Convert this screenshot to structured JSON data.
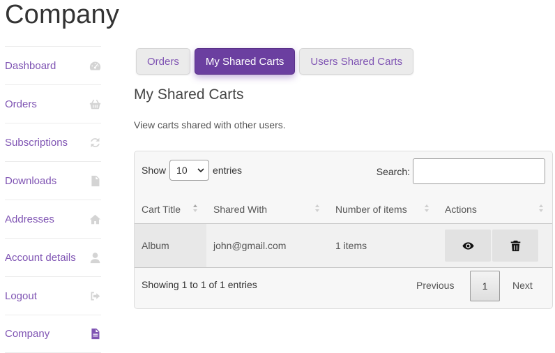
{
  "page": {
    "title": "Company"
  },
  "sidebar": {
    "items": [
      {
        "label": "Dashboard",
        "icon": "dashboard-icon"
      },
      {
        "label": "Orders",
        "icon": "basket-icon"
      },
      {
        "label": "Subscriptions",
        "icon": "refresh-icon"
      },
      {
        "label": "Downloads",
        "icon": "file-icon"
      },
      {
        "label": "Addresses",
        "icon": "home-icon"
      },
      {
        "label": "Account details",
        "icon": "user-icon"
      },
      {
        "label": "Logout",
        "icon": "sign-out-icon"
      },
      {
        "label": "Company",
        "icon": "document-icon",
        "active": true
      }
    ]
  },
  "tabs": [
    {
      "label": "Orders"
    },
    {
      "label": "My Shared Carts",
      "active": true
    },
    {
      "label": "Users Shared Carts"
    }
  ],
  "section": {
    "title": "My Shared Carts",
    "description": "View carts shared with other users."
  },
  "table": {
    "show_label": "Show",
    "entries_value": "10",
    "entries_label": "entries",
    "search_label": "Search:",
    "search_value": "",
    "columns": [
      "Cart Title",
      "Shared With",
      "Number of items",
      "Actions"
    ],
    "rows": [
      {
        "title": "Album",
        "shared_with": "john@gmail.com",
        "items": "1 items"
      }
    ],
    "info": "Showing 1 to 1 of 1 entries",
    "pagination": {
      "previous": "Previous",
      "current": "1",
      "next": "Next"
    }
  },
  "colors": {
    "accent": "#7f54b3",
    "active_tab": "#6b3fa0",
    "icon_muted": "#d4d4d4"
  }
}
